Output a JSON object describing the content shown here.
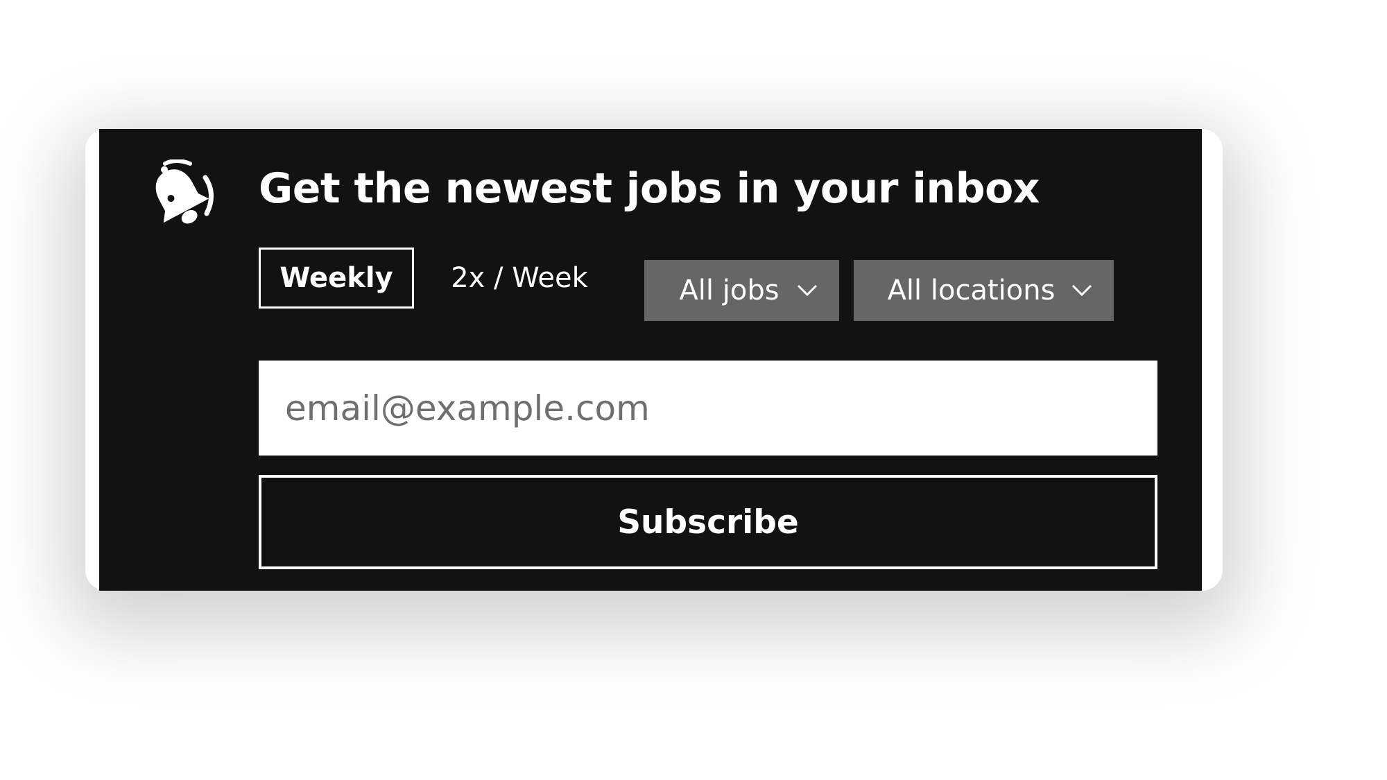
{
  "widget": {
    "title": "Get the newest jobs in your inbox",
    "icon": "bell-ringing-icon",
    "frequency": {
      "options": [
        {
          "label": "Weekly",
          "selected": true
        },
        {
          "label": "2x / Week",
          "selected": false
        }
      ]
    },
    "filters": {
      "jobs_label": "All jobs",
      "locations_label": "All locations"
    },
    "email": {
      "value": "",
      "placeholder": "email@example.com"
    },
    "subscribe_label": "Subscribe"
  },
  "colors": {
    "card_background": "#121212",
    "dropdown_background": "#666666",
    "text": "#ffffff",
    "input_background": "#ffffff",
    "placeholder": "#6f6f6f"
  }
}
